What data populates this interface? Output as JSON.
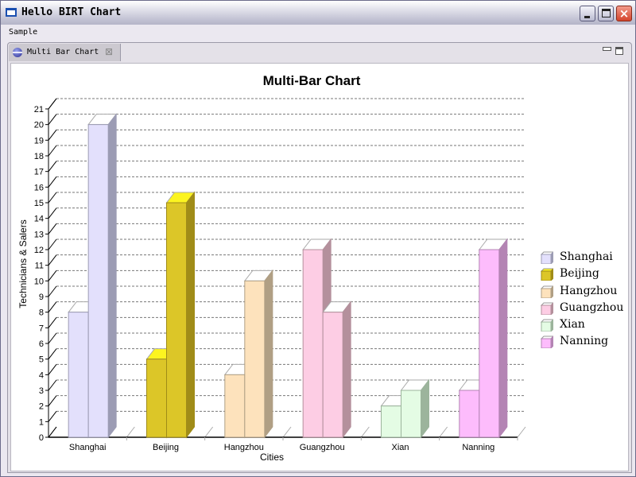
{
  "window": {
    "title": "Hello BIRT Chart",
    "buttons": {
      "minimize": "minimize",
      "maximize": "maximize",
      "close": "×"
    }
  },
  "menubar": {
    "items": [
      {
        "label": "Sample"
      }
    ]
  },
  "view": {
    "tab_label": "Multi Bar Chart",
    "tab_close": "⊠"
  },
  "chart_data": {
    "type": "bar",
    "style": "3d-side-by-side",
    "title": "Multi-Bar Chart",
    "xlabel": "Cities",
    "ylabel": "Technicians & Salers",
    "categories": [
      "Shanghai",
      "Beijing",
      "Hangzhou",
      "Guangzhou",
      "Xian",
      "Nanning"
    ],
    "series": [
      {
        "name": "Technicians",
        "values": [
          8,
          5,
          4,
          12,
          2,
          3
        ]
      },
      {
        "name": "Salers",
        "values": [
          20,
          15,
          10,
          8,
          3,
          12
        ]
      }
    ],
    "ylim": [
      0,
      21
    ],
    "yticks": [
      0,
      1,
      2,
      3,
      4,
      5,
      6,
      7,
      8,
      9,
      10,
      11,
      12,
      13,
      14,
      15,
      16,
      17,
      18,
      19,
      20,
      21
    ],
    "grid": true,
    "grid_style": "dashed",
    "legend": {
      "placement": "right",
      "entries": [
        "Shanghai",
        "Beijing",
        "Hangzhou",
        "Guangzhou",
        "Xian",
        "Nanning"
      ]
    },
    "category_colors": {
      "Shanghai": {
        "front": "#e3e0fc",
        "side": "#9c9cb4",
        "top": "#ffffff",
        "edge": "#9c9cb4"
      },
      "Beijing": {
        "front": "#dcc628",
        "side": "#a08c18",
        "top": "#fcf420",
        "edge": "#a08c18"
      },
      "Hangzhou": {
        "front": "#fde2bc",
        "side": "#b09f84",
        "top": "#ffffff",
        "edge": "#b09f84"
      },
      "Guangzhou": {
        "front": "#fdcde4",
        "side": "#b4909c",
        "top": "#ffffff",
        "edge": "#b4909c"
      },
      "Xian": {
        "front": "#e4fce4",
        "side": "#9cb49c",
        "top": "#ffffff",
        "edge": "#9cb49c"
      },
      "Nanning": {
        "front": "#fdbcfc",
        "side": "#b484b4",
        "top": "#ffffff",
        "edge": "#b484b4"
      }
    }
  }
}
